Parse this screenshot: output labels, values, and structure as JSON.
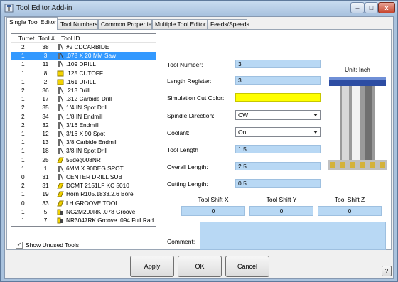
{
  "window": {
    "title": "Tool Editor Add-in",
    "min_label": "–",
    "max_label": "□",
    "close_label": "x"
  },
  "tabs": [
    {
      "label": "Single Tool Editor",
      "active": true
    },
    {
      "label": "Tool Numbers",
      "active": false
    },
    {
      "label": "Common Properties",
      "active": false
    },
    {
      "label": "Multiple Tool Editor",
      "active": false
    },
    {
      "label": "Feeds/Speeds",
      "active": false
    }
  ],
  "tool_list": {
    "headers": {
      "turret": "Turret",
      "tool": "Tool #",
      "id": "Tool ID"
    },
    "rows": [
      {
        "turret": "2",
        "tool": "38",
        "id": "#2 CDCARBIDE",
        "icon": "drill-icon"
      },
      {
        "turret": "1",
        "tool": "3",
        "id": ".078 X 20 MM Saw",
        "icon": "drill-icon",
        "selected": true
      },
      {
        "turret": "1",
        "tool": "11",
        "id": ".109 DRILL",
        "icon": "drill-icon"
      },
      {
        "turret": "1",
        "tool": "8",
        "id": ".125 CUTOFF",
        "icon": "cutoff-icon"
      },
      {
        "turret": "1",
        "tool": "2",
        "id": ".161 DRILL",
        "icon": "cutoff-icon"
      },
      {
        "turret": "2",
        "tool": "36",
        "id": ".213 Drill",
        "icon": "drill-icon"
      },
      {
        "turret": "1",
        "tool": "17",
        "id": ".312 Carbide Drill",
        "icon": "drill-icon"
      },
      {
        "turret": "2",
        "tool": "35",
        "id": "1/4 IN Spot Drill",
        "icon": "drill-icon"
      },
      {
        "turret": "2",
        "tool": "34",
        "id": "1/8 IN Endmill",
        "icon": "drill-icon"
      },
      {
        "turret": "2",
        "tool": "32",
        "id": "3/16 Endmill",
        "icon": "drill-icon"
      },
      {
        "turret": "1",
        "tool": "12",
        "id": "3/16 X 90 Spot",
        "icon": "drill-icon"
      },
      {
        "turret": "1",
        "tool": "13",
        "id": "3/8 Carbide Endmill",
        "icon": "drill-icon"
      },
      {
        "turret": "1",
        "tool": "18",
        "id": "3/8 IN Spot Drill",
        "icon": "drill-icon"
      },
      {
        "turret": "1",
        "tool": "25",
        "id": "55deg008NR",
        "icon": "insert-icon"
      },
      {
        "turret": "1",
        "tool": "1",
        "id": "6MM X 90DEG SPOT",
        "icon": "drill-icon"
      },
      {
        "turret": "0",
        "tool": "31",
        "id": "CENTER DRILL SUB",
        "icon": "drill-icon"
      },
      {
        "turret": "2",
        "tool": "31",
        "id": "DCMT 2151LF KC 5010",
        "icon": "insert-icon"
      },
      {
        "turret": "1",
        "tool": "19",
        "id": "Horn R105.1833.2.6 Bore",
        "icon": "insert-icon"
      },
      {
        "turret": "0",
        "tool": "33",
        "id": "LH GROOVE TOOL",
        "icon": "insert-icon"
      },
      {
        "turret": "1",
        "tool": "5",
        "id": "NG2M200RK .078 Groove",
        "icon": "groove-icon"
      },
      {
        "turret": "1",
        "tool": "7",
        "id": "NR3047RK Groove .094 Full Rad",
        "icon": "groove-icon"
      }
    ]
  },
  "show_unused": {
    "label": "Show Unused Tools",
    "checked": true,
    "check_mark": "✓"
  },
  "form": {
    "tool_number": {
      "label": "Tool Number:",
      "value": "3"
    },
    "length_register": {
      "label": "Length Register:",
      "value": "3"
    },
    "sim_color": {
      "label": "Simulation Cut Color:",
      "value": "#ffff00"
    },
    "spindle": {
      "label": "Spindle Direction:",
      "value": "CW"
    },
    "coolant": {
      "label": "Coolant:",
      "value": "On"
    },
    "tool_length": {
      "label": "Tool Length",
      "value": "1.5"
    },
    "overall_length": {
      "label": "Overall Length:",
      "value": "2.5"
    },
    "cutting_length": {
      "label": "Cutting Length:",
      "value": "0.5"
    },
    "shift_x": {
      "label": "Tool Shift X",
      "value": "0"
    },
    "shift_y": {
      "label": "Tool Shift Y",
      "value": "0"
    },
    "shift_z": {
      "label": "Tool Shift Z",
      "value": "0"
    },
    "comment": {
      "label": "Comment:",
      "value": ""
    }
  },
  "preview": {
    "unit_label": "Unit: Inch"
  },
  "buttons": {
    "apply": "Apply",
    "ok": "OK",
    "cancel": "Cancel",
    "help": "?"
  }
}
